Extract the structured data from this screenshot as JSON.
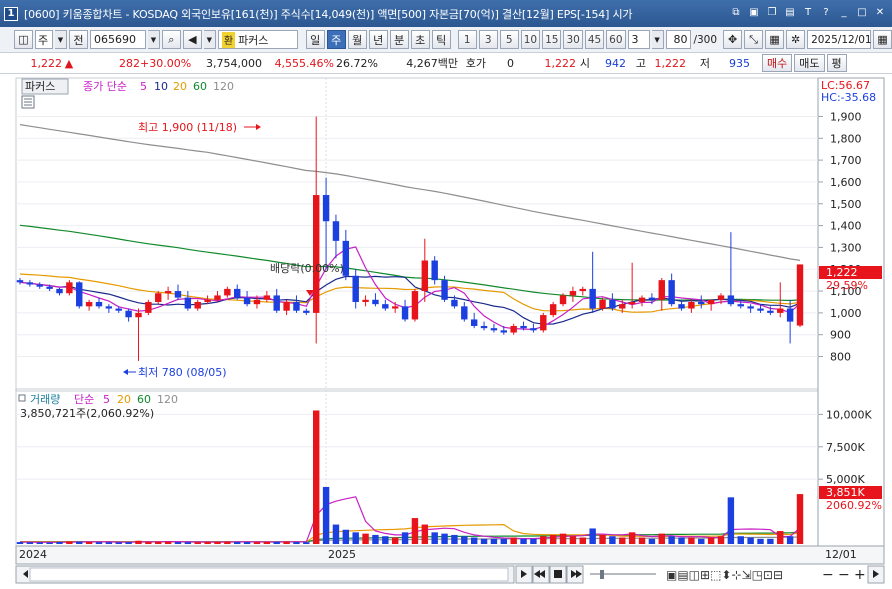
{
  "window": {
    "number": "1",
    "title": "[0600] 키움종합차트 - KOSDAQ 외국인보유[161(천)] 주식수[14,049(천)] 액면[500] 자본금[70(억)] 결산[12월] EPS[-154] 시가"
  },
  "toolbar": {
    "market": "주",
    "prefix": "전",
    "code": "065690",
    "hwan": "환",
    "name": "파커스",
    "periods": [
      "일",
      "주",
      "월",
      "년",
      "분",
      "초",
      "틱"
    ],
    "selected_period": "주",
    "intervals": [
      "1",
      "3",
      "5",
      "10",
      "15",
      "30",
      "45",
      "60"
    ],
    "interval_value": "3",
    "count": "80",
    "count_total": "/300",
    "date": "2025/12/01"
  },
  "quote": {
    "price": "1,222",
    "change": "282",
    "change_rate": "+30.00%",
    "volume": "3,754,000",
    "vol_rate": "4,555.46%",
    "turnover": "26.72%",
    "amount": "4,267백만",
    "hoga_label": "호가",
    "hoga_value": "0",
    "hoga_price": "1,222",
    "open_label": "시",
    "open": "942",
    "high_label": "고",
    "high": "1,222",
    "low_label": "저",
    "low": "935",
    "buy_label": "매수",
    "sell_label": "매도",
    "avg_label": "평"
  },
  "price_panel": {
    "name_tag": "파커스",
    "ma_label": "종가 단순",
    "ma_periods": [
      "5",
      "10",
      "20",
      "60",
      "120"
    ],
    "lc": "LC:56.67",
    "hc": "HC:-35.68",
    "y_ticks": [
      "1,900",
      "1,800",
      "1,700",
      "1,600",
      "1,500",
      "1,400",
      "1,300",
      "1,200",
      "1,100",
      "1,000",
      "900",
      "800"
    ],
    "current_price": "1,222",
    "current_pct": "29.59%",
    "max_annotation": "최고 1,900 (11/18)",
    "min_annotation": "최저 780 (08/05)",
    "event_annotation": "배당락(0.00%)"
  },
  "volume_panel": {
    "label": "거래량",
    "ma_label": "단순",
    "ma_periods": [
      "5",
      "20",
      "60",
      "120"
    ],
    "current_text": "3,850,721주(2,060.92%)",
    "y_ticks": [
      "10,000K",
      "7,500K",
      "5,000K"
    ],
    "current_volume": "3,851K",
    "current_volume_pct": "2060.92%"
  },
  "x_axis": {
    "labels": [
      "2024",
      "2025"
    ],
    "last_date": "12/01"
  },
  "colors": {
    "up": "#e8141b",
    "down": "#1c3fe0",
    "ma5": "#c81fc8",
    "ma10": "#1a2a8c",
    "ma20": "#e69a00",
    "ma60": "#128a2c",
    "ma120": "#8e8e8e",
    "title_bar": "#2f5c98"
  },
  "chart_data": {
    "type": "candlestick",
    "weekly_ohlc": [
      [
        1150,
        1160,
        1130,
        1140
      ],
      [
        1140,
        1150,
        1120,
        1130
      ],
      [
        1130,
        1140,
        1110,
        1120
      ],
      [
        1120,
        1130,
        1100,
        1110
      ],
      [
        1110,
        1115,
        1080,
        1090
      ],
      [
        1090,
        1150,
        1080,
        1140
      ],
      [
        1140,
        1145,
        1020,
        1030
      ],
      [
        1030,
        1060,
        1010,
        1050
      ],
      [
        1050,
        1070,
        1020,
        1030
      ],
      [
        1030,
        1040,
        1000,
        1020
      ],
      [
        1020,
        1030,
        1000,
        1010
      ],
      [
        1010,
        1020,
        960,
        980
      ],
      [
        980,
        1020,
        780,
        1000
      ],
      [
        1000,
        1060,
        990,
        1050
      ],
      [
        1050,
        1100,
        1040,
        1090
      ],
      [
        1090,
        1120,
        1060,
        1100
      ],
      [
        1100,
        1130,
        1060,
        1070
      ],
      [
        1070,
        1100,
        1010,
        1020
      ],
      [
        1020,
        1060,
        1010,
        1050
      ],
      [
        1050,
        1080,
        1040,
        1060
      ],
      [
        1060,
        1100,
        1050,
        1080
      ],
      [
        1080,
        1120,
        1070,
        1110
      ],
      [
        1110,
        1130,
        1060,
        1070
      ],
      [
        1070,
        1100,
        1030,
        1040
      ],
      [
        1040,
        1080,
        1020,
        1060
      ],
      [
        1060,
        1100,
        1050,
        1080
      ],
      [
        1080,
        1110,
        1000,
        1010
      ],
      [
        1010,
        1060,
        990,
        1050
      ],
      [
        1050,
        1080,
        1000,
        1010
      ],
      [
        1010,
        1020,
        990,
        1000
      ],
      [
        1000,
        1900,
        860,
        1540
      ],
      [
        1540,
        1620,
        1200,
        1420
      ],
      [
        1420,
        1450,
        1250,
        1330
      ],
      [
        1330,
        1380,
        1150,
        1170
      ],
      [
        1170,
        1200,
        1020,
        1050
      ],
      [
        1050,
        1080,
        1030,
        1060
      ],
      [
        1060,
        1090,
        1030,
        1040
      ],
      [
        1040,
        1060,
        1010,
        1020
      ],
      [
        1020,
        1050,
        1000,
        1030
      ],
      [
        1030,
        1060,
        960,
        970
      ],
      [
        970,
        1110,
        960,
        1100
      ],
      [
        1100,
        1340,
        1050,
        1240
      ],
      [
        1240,
        1260,
        1130,
        1150
      ],
      [
        1150,
        1170,
        1050,
        1060
      ],
      [
        1060,
        1080,
        1020,
        1030
      ],
      [
        1030,
        1050,
        960,
        970
      ],
      [
        970,
        1000,
        930,
        940
      ],
      [
        940,
        960,
        920,
        930
      ],
      [
        930,
        950,
        910,
        920
      ],
      [
        920,
        940,
        900,
        910
      ],
      [
        910,
        950,
        900,
        940
      ],
      [
        940,
        960,
        920,
        930
      ],
      [
        930,
        950,
        910,
        920
      ],
      [
        920,
        1000,
        910,
        990
      ],
      [
        990,
        1050,
        980,
        1040
      ],
      [
        1040,
        1090,
        1030,
        1080
      ],
      [
        1080,
        1120,
        1050,
        1100
      ],
      [
        1100,
        1120,
        1080,
        1110
      ],
      [
        1110,
        1280,
        1000,
        1020
      ],
      [
        1020,
        1070,
        1010,
        1060
      ],
      [
        1060,
        1090,
        1010,
        1020
      ],
      [
        1020,
        1060,
        1000,
        1040
      ],
      [
        1040,
        1230,
        1020,
        1050
      ],
      [
        1050,
        1080,
        1030,
        1070
      ],
      [
        1070,
        1090,
        1040,
        1060
      ],
      [
        1060,
        1160,
        1010,
        1150
      ],
      [
        1150,
        1180,
        1030,
        1040
      ],
      [
        1040,
        1060,
        1010,
        1020
      ],
      [
        1020,
        1060,
        1000,
        1050
      ],
      [
        1050,
        1080,
        1020,
        1040
      ],
      [
        1040,
        1060,
        1010,
        1060
      ],
      [
        1060,
        1090,
        1040,
        1080
      ],
      [
        1080,
        1370,
        1030,
        1040
      ],
      [
        1040,
        1060,
        1020,
        1030
      ],
      [
        1030,
        1040,
        1000,
        1020
      ],
      [
        1020,
        1040,
        1000,
        1010
      ],
      [
        1010,
        1030,
        990,
        1000
      ],
      [
        1000,
        1140,
        980,
        1020
      ],
      [
        1020,
        1060,
        860,
        960
      ],
      [
        942,
        1222,
        935,
        1222
      ]
    ],
    "weekly_volume_k": [
      150,
      130,
      120,
      110,
      160,
      200,
      180,
      150,
      140,
      130,
      120,
      150,
      250,
      160,
      170,
      180,
      150,
      140,
      130,
      160,
      170,
      180,
      160,
      150,
      140,
      160,
      170,
      180,
      150,
      140,
      10300,
      4400,
      1500,
      1100,
      900,
      800,
      700,
      600,
      500,
      900,
      2000,
      1500,
      900,
      800,
      700,
      600,
      500,
      400,
      400,
      400,
      500,
      400,
      400,
      600,
      700,
      800,
      600,
      500,
      1200,
      700,
      600,
      500,
      900,
      500,
      400,
      800,
      600,
      500,
      500,
      400,
      500,
      600,
      3600,
      600,
      500,
      400,
      400,
      1000,
      600,
      3850
    ]
  }
}
